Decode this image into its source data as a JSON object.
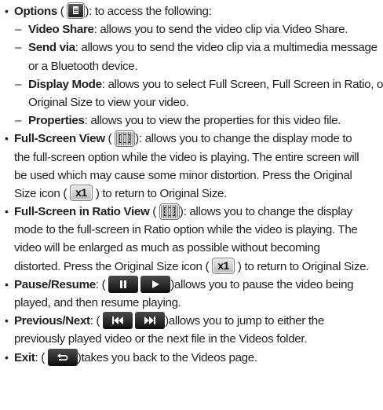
{
  "options": {
    "title": "Options",
    "text": "): to access the following:",
    "icon": "options-menu-icon",
    "sub": [
      {
        "title": "Video Share",
        "text": ": allows you to send the video clip via Video Share."
      },
      {
        "title": "Send via",
        "text": ": allows you to send the video clip via a multimedia message",
        "text2": "or a Bluetooth device."
      },
      {
        "title": "Display Mode",
        "text": ": allows you to select Full Screen, Full Screen in Ratio, or",
        "text2": "Original Size to view your video."
      },
      {
        "title": "Properties",
        "text": ": allows you to view the properties for this video file."
      }
    ]
  },
  "full_screen": {
    "title": "Full-Screen View",
    "line1_tail": "): allows you to change the display mode to",
    "line2": "the full-screen option while the video is playing. The entire screen will",
    "line3": "be used which may cause some minor distortion. Press the Original",
    "line4_head": "Size icon (",
    "line4_tail": ") to return to Original Size."
  },
  "full_ratio": {
    "title": "Full-Screen in Ratio View",
    "line1_tail": "): allows you to change the display",
    "line2": "mode to the full-screen in Ratio option while the video is playing. The",
    "line3": "video will be enlarged as much as possible without becoming",
    "line4_head": "distorted. Press the Original Size icon (",
    "line4_tail": ") to return to Original Size."
  },
  "x1_label": "x1",
  "pause": {
    "title": "Pause/Resume",
    "colon": ": (",
    "line1_tail": ")allows you to pause the video being",
    "line2": "played, and then resume playing."
  },
  "prevnext": {
    "title": "Previous/Next",
    "colon": ": (",
    "line1_tail": ")allows you to jump to either the",
    "line2": "previously played video or the next file in the Videos folder."
  },
  "exit": {
    "title": "Exit",
    "colon": ": (",
    "tail": ")takes you back to the Videos page."
  },
  "bullet": "•",
  "dash": "–",
  "open_paren": " ("
}
